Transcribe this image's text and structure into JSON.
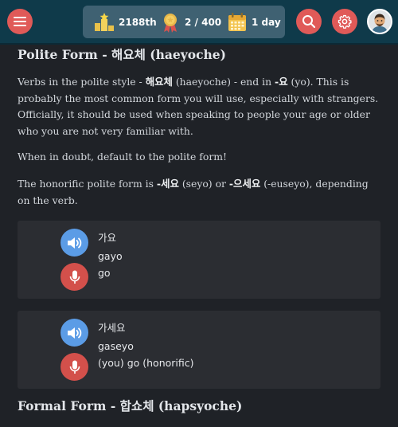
{
  "header": {
    "menu_icon": "hamburger-icon",
    "stats": {
      "points": {
        "icon": "podium-icon",
        "label": "2188th"
      },
      "progress": {
        "icon": "medal-icon",
        "label": "2 / 400"
      },
      "streak": {
        "icon": "calendar-icon",
        "label": "1 day"
      }
    },
    "search_icon": "search-icon",
    "settings_icon": "gear-icon",
    "avatar_icon": "user-avatar"
  },
  "section": {
    "title": "Polite Form - 해요체 (haeyoche)",
    "para1": {
      "t1": "Verbs in the polite style - ",
      "b1": "해요체",
      "t2": " (haeyoche) - end in ",
      "b2": "-요",
      "t3": " (yo). This is probably the most common form you will use, especially with strangers. Officially, it should be used when speaking to people your age or older who you are not very familiar with."
    },
    "para2": "When in doubt, default to the polite form!",
    "para3": {
      "t1": "The honorific polite form is ",
      "b1": "-세요",
      "t2": " (seyo) or ",
      "b2": "-으세요",
      "t3": " (-euseyo), depending on the verb."
    }
  },
  "examples": [
    {
      "korean": "가요",
      "romanization": "gayo",
      "english": "go"
    },
    {
      "korean": "가세요",
      "romanization": "gaseyo",
      "english": "(you) go (honorific)"
    }
  ],
  "next_section": {
    "title": "Formal Form - 합쇼체 (hapsyoche)"
  },
  "colors": {
    "topbar": "#0f3a4a",
    "stats_bg": "#3f6172",
    "red_button": "#e05a58",
    "play_button": "#5b9ce6",
    "mic_button": "#d3504b",
    "background": "#1f2227",
    "card": "#2b2d32"
  }
}
